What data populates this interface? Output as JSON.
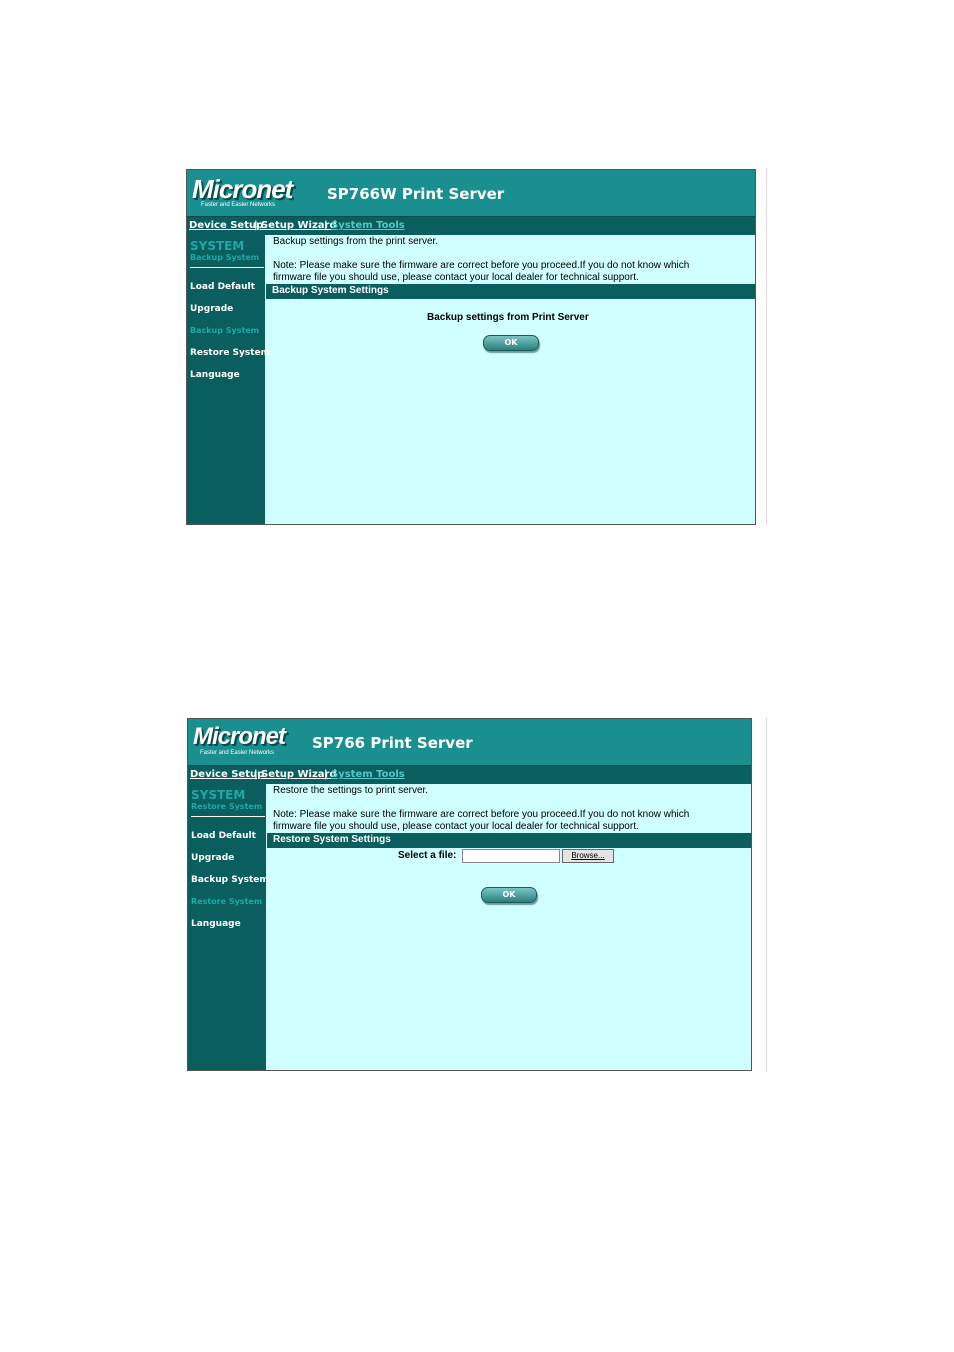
{
  "brand": {
    "logo": "Micronet",
    "tagline": "Faster and Easier Networks"
  },
  "nav": {
    "device_setup": "Device Setup",
    "sep": "|",
    "setup_wizard": "Setup Wizard",
    "system_tools": "System Tools"
  },
  "panel1": {
    "title": "SP766W Print Server",
    "sidebar": {
      "section": "SYSTEM",
      "current": "Backup System",
      "items": [
        "Load Default",
        "Upgrade",
        "Backup System",
        "Restore System",
        "Language"
      ]
    },
    "intro": "Backup settings from the print server.",
    "note_line1": "Note: Please make sure the firmware are correct before you proceed.If you do not know which",
    "note_line2": "firmware file you should use, please contact your local dealer for technical support.",
    "bar_label": "Backup System Settings",
    "body_label": "Backup settings from Print Server",
    "ok_label": "OK"
  },
  "panel2": {
    "title": "SP766 Print Server",
    "sidebar": {
      "section": "SYSTEM",
      "current": "Restore System",
      "items": [
        "Load Default",
        "Upgrade",
        "Backup System",
        "Restore System",
        "Language"
      ]
    },
    "intro": "Restore the settings to print server.",
    "note_line1": "Note: Please make sure the firmware are correct before you proceed.If you do not know which",
    "note_line2": "firmware file you should use, please contact your local dealer for technical support.",
    "bar_label": "Restore System Settings",
    "file_label": "Select a file:",
    "file_value": "",
    "browse_label": "Browse...",
    "ok_label": "OK"
  }
}
